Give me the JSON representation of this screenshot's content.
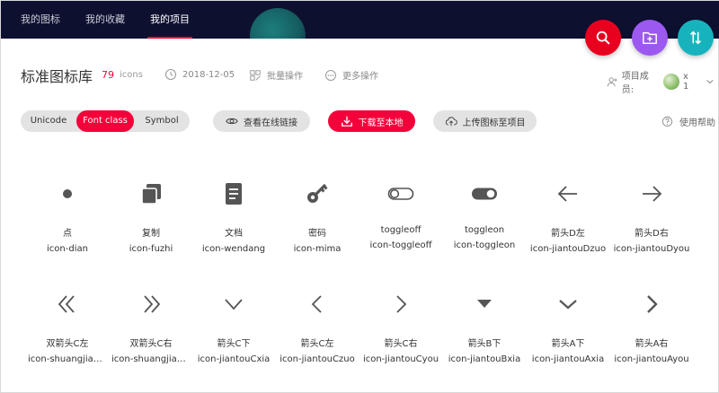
{
  "nav": {
    "tabs": [
      {
        "label": "我的图标"
      },
      {
        "label": "我的收藏"
      },
      {
        "label": "我的项目"
      }
    ]
  },
  "colors": {
    "accent": "#f4003a",
    "nav_bg": "#0e1030",
    "fab_search": "#e8001f",
    "fab_add": "#9b59ef",
    "fab_sort": "#17b3bd"
  },
  "header": {
    "title": "标准图标库",
    "count": "79",
    "count_unit": "icons",
    "date": "2018-12-05",
    "batch": "批量操作",
    "more": "更多操作",
    "members_label": "项目成员:",
    "members_count": "x 1"
  },
  "toolbar": {
    "seg": [
      "Unicode",
      "Font class",
      "Symbol"
    ],
    "view_online": "查看在线链接",
    "download": "下载至本地",
    "upload": "上传图标至项目",
    "help": "使用帮助"
  },
  "icons": [
    {
      "cn": "点",
      "en": "icon-dian",
      "glyph": "dot-icon"
    },
    {
      "cn": "复制",
      "en": "icon-fuzhi",
      "glyph": "copy-icon"
    },
    {
      "cn": "文档",
      "en": "icon-wendang",
      "glyph": "document-icon"
    },
    {
      "cn": "密码",
      "en": "icon-mima",
      "glyph": "key-icon"
    },
    {
      "cn": "toggleoff",
      "en": "icon-toggleoff",
      "glyph": "toggle-off-icon"
    },
    {
      "cn": "toggleon",
      "en": "icon-toggleon",
      "glyph": "toggle-on-icon"
    },
    {
      "cn": "箭头D左",
      "en": "icon-jiantouDzuo",
      "glyph": "arrow-left-icon"
    },
    {
      "cn": "箭头D右",
      "en": "icon-jiantouDyou",
      "glyph": "arrow-right-icon"
    },
    {
      "cn": "双箭头C左",
      "en": "icon-shuangjiantouCzuo",
      "glyph": "double-chevron-left-icon"
    },
    {
      "cn": "双箭头C右",
      "en": "icon-shuangjiantouCyou",
      "glyph": "double-chevron-right-icon"
    },
    {
      "cn": "箭头C下",
      "en": "icon-jiantouCxia",
      "glyph": "chevron-down-icon"
    },
    {
      "cn": "箭头C左",
      "en": "icon-jiantouCzuo",
      "glyph": "chevron-left-icon"
    },
    {
      "cn": "箭头C右",
      "en": "icon-jiantouCyou",
      "glyph": "chevron-right-icon"
    },
    {
      "cn": "箭头B下",
      "en": "icon-jiantouBxia",
      "glyph": "triangle-down-icon"
    },
    {
      "cn": "箭头A下",
      "en": "icon-jiantouAxia",
      "glyph": "chevron-down-thin-icon"
    },
    {
      "cn": "箭头A右",
      "en": "icon-jiantouAyou",
      "glyph": "chevron-right-bold-icon"
    }
  ]
}
